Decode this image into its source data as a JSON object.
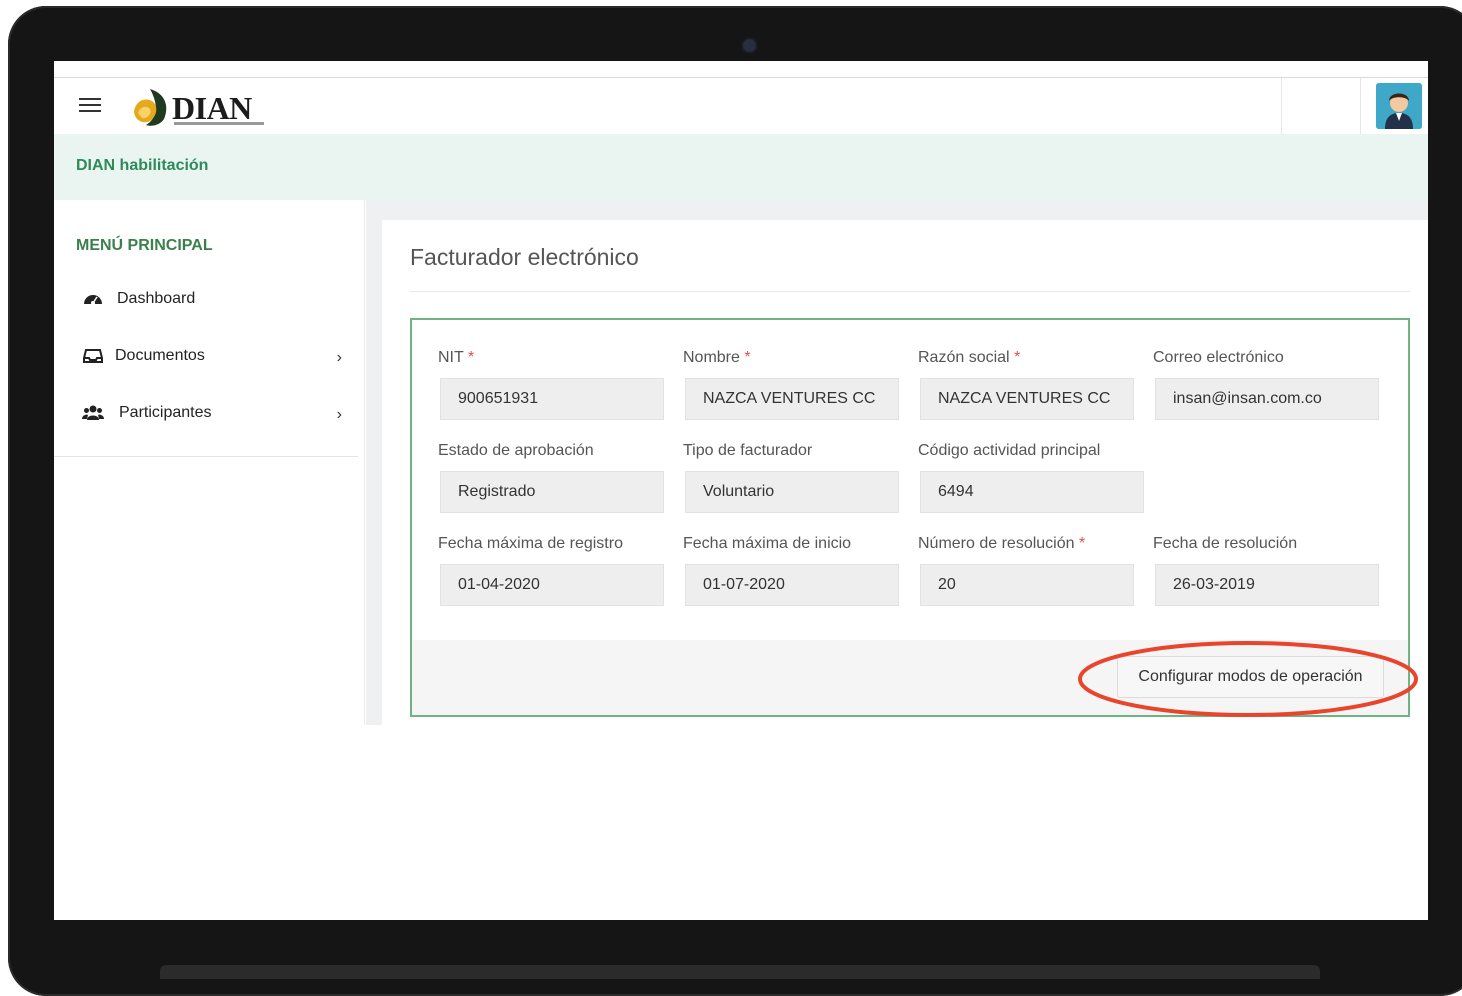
{
  "header": {
    "logo_text": "DIAN",
    "menu_icon": "hamburger-menu-icon",
    "avatar_icon": "user-avatar-icon"
  },
  "env_bar": {
    "label": "DIAN habilitación"
  },
  "sidebar": {
    "title": "MENÚ PRINCIPAL",
    "items": [
      {
        "label": "Dashboard",
        "icon": "dashboard-icon",
        "has_children": false
      },
      {
        "label": "Documentos",
        "icon": "inbox-icon",
        "has_children": true
      },
      {
        "label": "Participantes",
        "icon": "users-icon",
        "has_children": true
      }
    ],
    "chevron": "›"
  },
  "page": {
    "title": "Facturador electrónico"
  },
  "form": {
    "fields": [
      {
        "label": "NIT",
        "required": true,
        "value": "900651931"
      },
      {
        "label": "Nombre",
        "required": true,
        "value": "NAZCA VENTURES CC"
      },
      {
        "label": "Razón social",
        "required": true,
        "value": "NAZCA VENTURES CC"
      },
      {
        "label": "Correo electrónico",
        "required": false,
        "value": "insan@insan.com.co"
      },
      {
        "label": "Estado de aprobación",
        "required": false,
        "value": "Registrado"
      },
      {
        "label": "Tipo de facturador",
        "required": false,
        "value": "Voluntario"
      },
      {
        "label": "Código actividad principal",
        "required": false,
        "value": "6494"
      },
      {
        "label": "Fecha máxima de registro",
        "required": false,
        "value": "01-04-2020"
      },
      {
        "label": "Fecha máxima de inicio",
        "required": false,
        "value": "01-07-2020"
      },
      {
        "label": "Número de resolución",
        "required": true,
        "value": "20"
      },
      {
        "label": "Fecha de resolución",
        "required": false,
        "value": "26-03-2019"
      }
    ],
    "required_mark": "*",
    "config_button": "Configurar modos de operación"
  },
  "colors": {
    "accent_green": "#2e8b57",
    "panel_border": "#6fb383",
    "env_bar_bg": "#eaf5f2",
    "highlight": "#e8452c",
    "required": "#d9534f"
  }
}
